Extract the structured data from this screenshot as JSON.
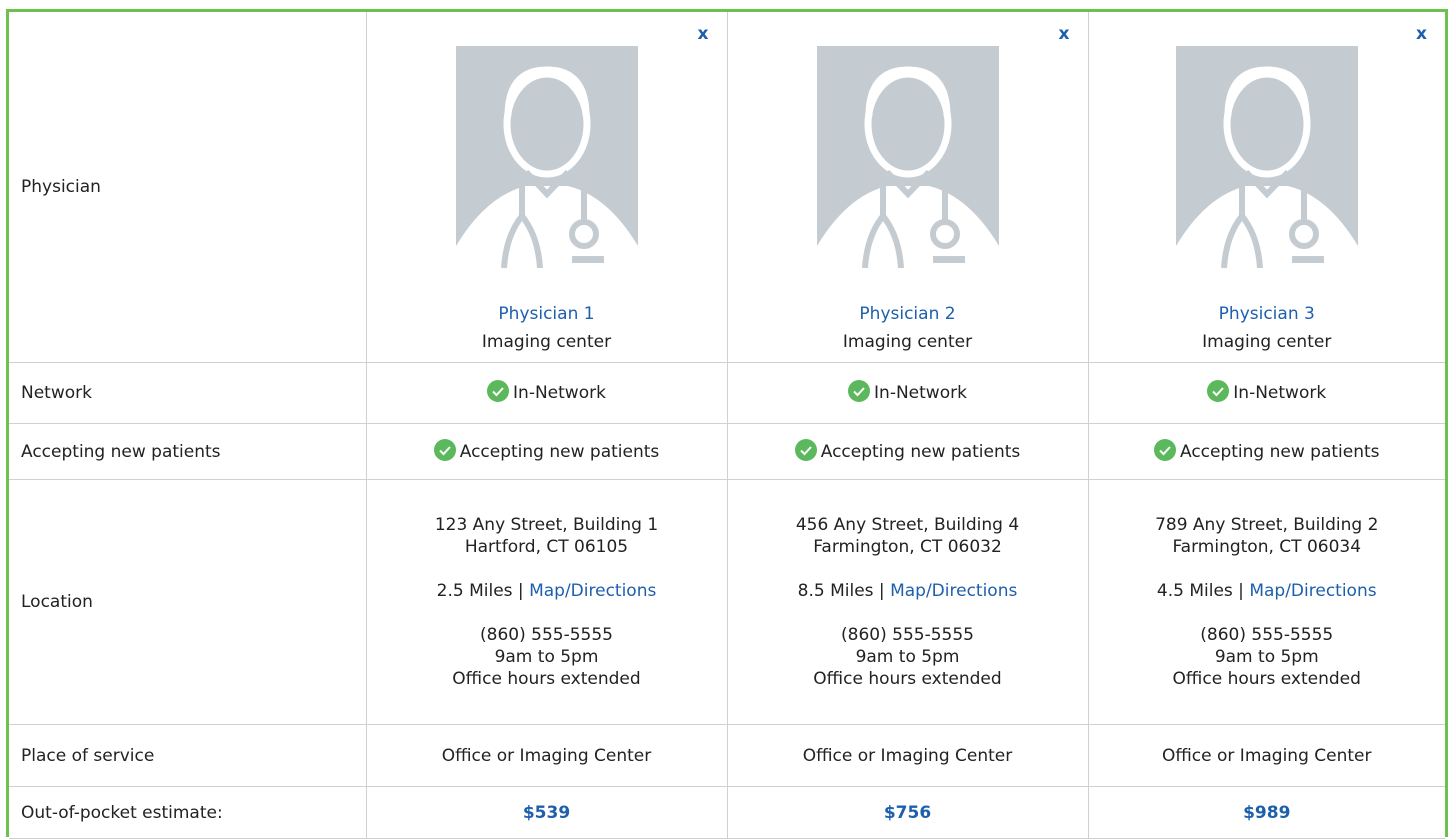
{
  "labels": {
    "physician": "Physician",
    "network": "Network",
    "accepting": "Accepting new patients",
    "location": "Location",
    "place": "Place of service",
    "estimate": "Out-of-pocket estimate:"
  },
  "close_label": "x",
  "physicians": [
    {
      "name": "Physician 1",
      "type": "Imaging center",
      "network": "In-Network",
      "accepting": "Accepting new patients",
      "address_line1": "123 Any Street, Building 1",
      "address_line2": "Hartford, CT 06105",
      "distance": "2.5 Miles |",
      "map_link": "Map/Directions",
      "phone": "(860) 555-5555",
      "hours": "9am to 5pm",
      "hours_note": "Office hours extended",
      "place": "Office or Imaging Center",
      "estimate": "$539"
    },
    {
      "name": "Physician 2",
      "type": "Imaging center",
      "network": "In-Network",
      "accepting": "Accepting new patients",
      "address_line1": "456 Any Street, Building 4",
      "address_line2": "Farmington, CT 06032",
      "distance": "8.5 Miles |",
      "map_link": "Map/Directions",
      "phone": "(860) 555-5555",
      "hours": "9am to 5pm",
      "hours_note": "Office hours extended",
      "place": "Office or Imaging Center",
      "estimate": "$756"
    },
    {
      "name": "Physician 3",
      "type": "Imaging center",
      "network": "In-Network",
      "accepting": "Accepting new patients",
      "address_line1": "789 Any Street, Building 2",
      "address_line2": "Farmington, CT 06034",
      "distance": "4.5 Miles |",
      "map_link": "Map/Directions",
      "phone": "(860) 555-5555",
      "hours": "9am to 5pm",
      "hours_note": "Office hours extended",
      "place": "Office or Imaging Center",
      "estimate": "$989"
    }
  ],
  "colors": {
    "frame_border": "#6cc14f",
    "link": "#1e5fad",
    "check": "#5cb85c",
    "avatar_bg": "#c4ccd2"
  }
}
